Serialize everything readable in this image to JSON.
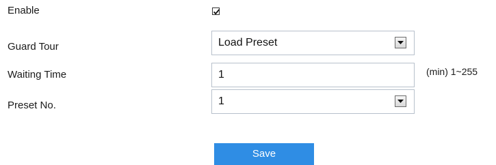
{
  "form": {
    "enable": {
      "label": "Enable",
      "checked": true
    },
    "guard_tour": {
      "label": "Guard Tour",
      "value": "Load Preset"
    },
    "waiting_time": {
      "label": "Waiting Time",
      "value": "1",
      "unit": "(min)  1~255"
    },
    "preset_no": {
      "label": "Preset No.",
      "value": "1"
    }
  },
  "actions": {
    "save_label": "Save"
  },
  "colors": {
    "save_button": "#2f8de4",
    "field_border": "#b7c0cb"
  }
}
